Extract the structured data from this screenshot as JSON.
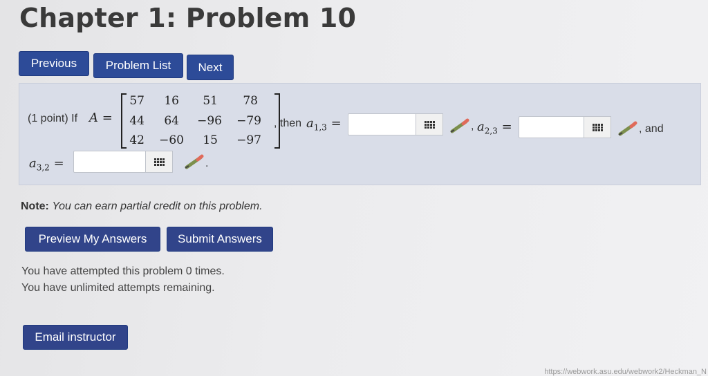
{
  "page": {
    "title": "Chapter 1: Problem 10"
  },
  "nav": {
    "previous": "Previous",
    "problem_list": "Problem List",
    "next": "Next"
  },
  "problem": {
    "points": "(1 point) If",
    "matrix_name": "A",
    "equals": "=",
    "matrix": [
      [
        "57",
        "16",
        "51",
        "78"
      ],
      [
        "44",
        "64",
        "−96",
        "−79"
      ],
      [
        "42",
        "−60",
        "15",
        "−97"
      ]
    ],
    "then": ", then",
    "a13_label": "a",
    "a13_sub": "1,3",
    "a23_label": "a",
    "a23_sub": "2,3",
    "a32_label": "a",
    "a32_sub": "3,2",
    "comma": ",",
    "and": ", and",
    "period": ".",
    "answers": {
      "a13": "",
      "a23": "",
      "a32": ""
    }
  },
  "note": {
    "label": "Note:",
    "text": "You can earn partial credit on this problem."
  },
  "actions": {
    "preview": "Preview My Answers",
    "submit": "Submit Answers"
  },
  "status": {
    "attempted": "You have attempted this problem 0 times.",
    "remaining": "You have unlimited attempts remaining."
  },
  "footer": {
    "email": "Email instructor",
    "url": "https://webwork.asu.edu/webwork2/Heckman_N"
  },
  "colors": {
    "button": "#2d4b98",
    "problem_bg": "#d9dde8"
  }
}
